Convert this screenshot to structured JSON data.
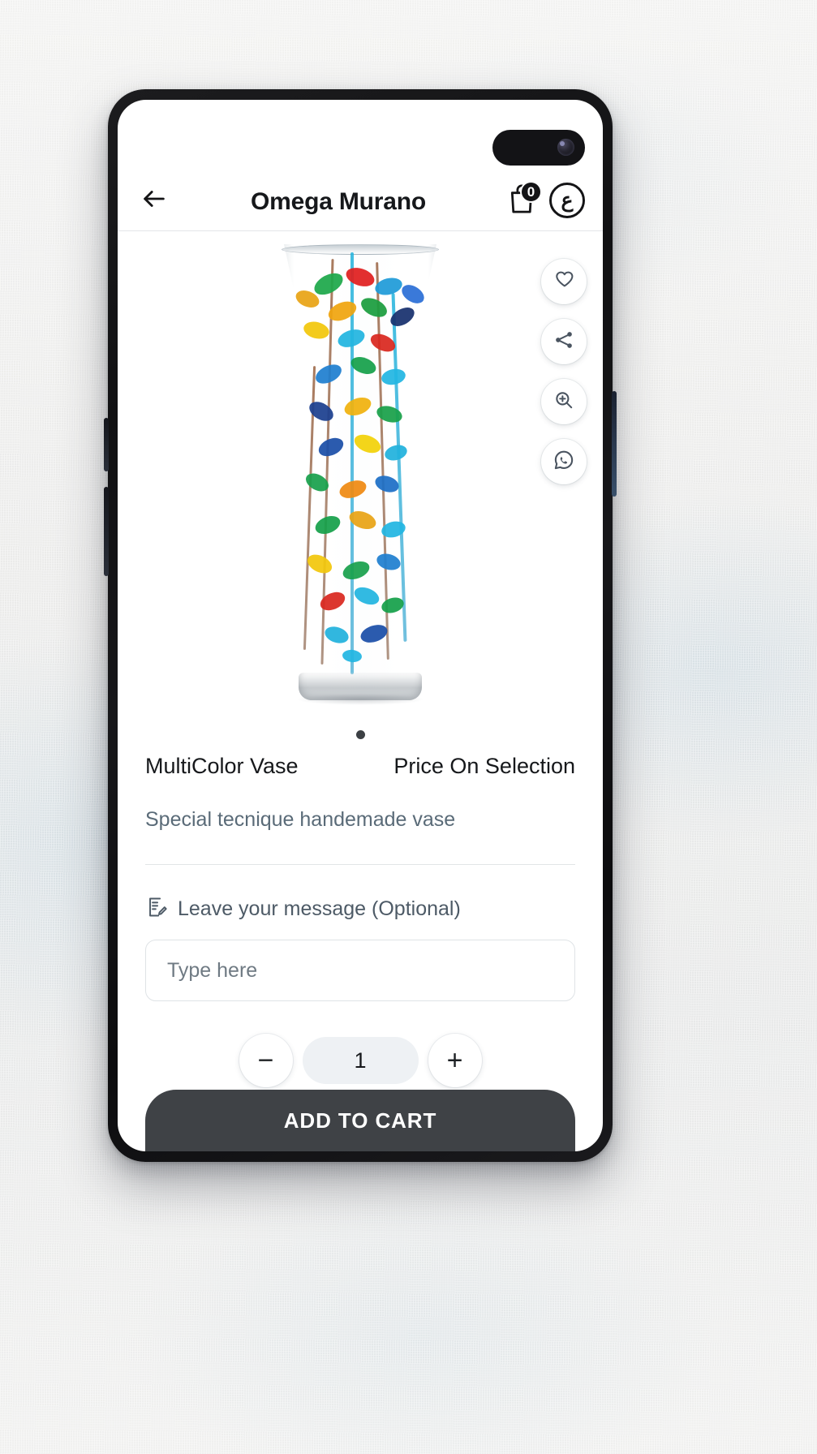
{
  "app": {
    "header": {
      "back_icon": "arrow-left-icon",
      "title": "Omega Murano",
      "cart_icon": "shopping-bag-icon",
      "cart_count": "0",
      "profile_icon": "currency-avatar-icon",
      "profile_glyph": "ع"
    }
  },
  "media": {
    "image_alt": "MultiColor Murano glass vase",
    "actions": [
      {
        "name": "favorite-fab",
        "icon": "heart-icon"
      },
      {
        "name": "share-fab",
        "icon": "share-icon"
      },
      {
        "name": "zoom-fab",
        "icon": "magnifier-plus-icon"
      },
      {
        "name": "whatsapp-fab",
        "icon": "whatsapp-icon"
      }
    ],
    "carousel": {
      "total_dots": 1,
      "active_index": 0
    }
  },
  "product": {
    "name": "MultiColor Vase",
    "price": "Price On Selection",
    "description": "Special tecnique handemade vase"
  },
  "message": {
    "icon": "note-edit-icon",
    "label": "Leave your message (Optional)",
    "placeholder": "Type here",
    "value": ""
  },
  "quantity": {
    "decrease_label": "−",
    "value": "1",
    "increase_label": "+"
  },
  "cta": {
    "add_to_cart_label": "ADD TO CART"
  },
  "colors": {
    "cta_background": "#3f4246",
    "text_primary": "#16181b",
    "text_muted": "#5a6b78",
    "qty_pill": "#eef1f4",
    "badge": "#141416"
  }
}
